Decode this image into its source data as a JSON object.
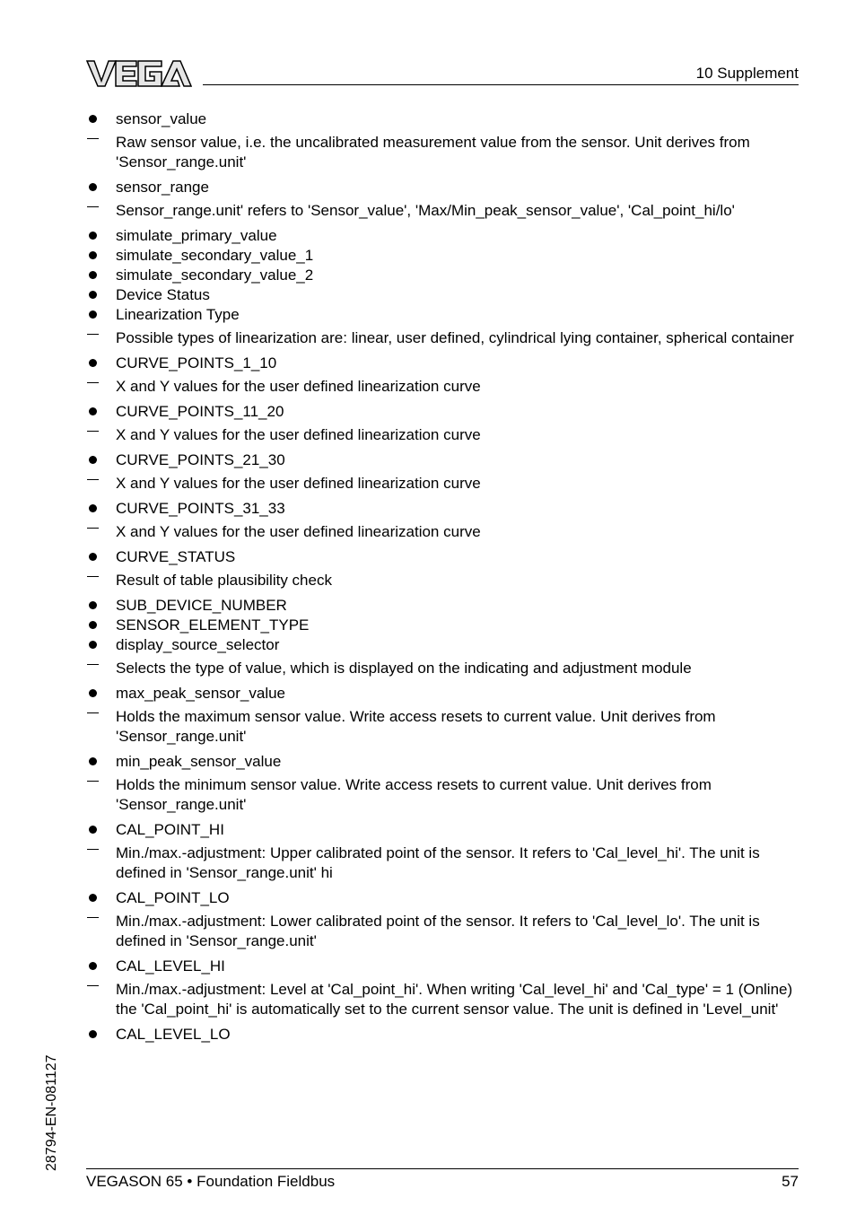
{
  "header": {
    "logo": "VEGA",
    "section": "10   Supplement"
  },
  "groups": [
    {
      "entries": [
        {
          "type": "bullet",
          "text": "sensor_value"
        },
        {
          "type": "dash",
          "text": "Raw sensor value, i.e. the uncalibrated measurement value from the sensor. Unit derives from 'Sensor_range.unit'"
        }
      ]
    },
    {
      "entries": [
        {
          "type": "bullet",
          "text": "sensor_range"
        },
        {
          "type": "dash",
          "text": "Sensor_range.unit' refers to 'Sensor_value', 'Max/Min_peak_sensor_value', 'Cal_point_hi/lo'"
        }
      ]
    },
    {
      "entries": [
        {
          "type": "bullet",
          "text": "simulate_primary_value"
        },
        {
          "type": "bullet",
          "text": "simulate_secondary_value_1"
        },
        {
          "type": "bullet",
          "text": "simulate_secondary_value_2"
        },
        {
          "type": "bullet",
          "text": "Device Status"
        },
        {
          "type": "bullet",
          "text": "Linearization Type"
        },
        {
          "type": "dash",
          "text": "Possible types of linearization are: linear, user defined, cylindrical lying container, spherical container"
        }
      ]
    },
    {
      "entries": [
        {
          "type": "bullet",
          "text": "CURVE_POINTS_1_10"
        },
        {
          "type": "dash",
          "text": "X and Y values for the user defined linearization curve"
        }
      ]
    },
    {
      "entries": [
        {
          "type": "bullet",
          "text": "CURVE_POINTS_11_20"
        },
        {
          "type": "dash",
          "text": "X and Y values for the user defined linearization curve"
        }
      ]
    },
    {
      "entries": [
        {
          "type": "bullet",
          "text": "CURVE_POINTS_21_30"
        },
        {
          "type": "dash",
          "text": "X and Y values for the user defined linearization curve"
        }
      ]
    },
    {
      "entries": [
        {
          "type": "bullet",
          "text": "CURVE_POINTS_31_33"
        },
        {
          "type": "dash",
          "text": "X and Y values for the user defined linearization curve"
        }
      ]
    },
    {
      "entries": [
        {
          "type": "bullet",
          "text": "CURVE_STATUS"
        },
        {
          "type": "dash",
          "text": "Result of table plausibility check"
        }
      ]
    },
    {
      "entries": [
        {
          "type": "bullet",
          "text": "SUB_DEVICE_NUMBER"
        },
        {
          "type": "bullet",
          "text": "SENSOR_ELEMENT_TYPE"
        },
        {
          "type": "bullet",
          "text": "display_source_selector"
        },
        {
          "type": "dash",
          "text": "Selects the type of value, which is displayed on the indicating and adjustment module"
        }
      ]
    },
    {
      "entries": [
        {
          "type": "bullet",
          "text": "max_peak_sensor_value"
        },
        {
          "type": "dash",
          "text": "Holds the maximum sensor value. Write access resets to current value. Unit derives from 'Sensor_range.unit'"
        }
      ]
    },
    {
      "entries": [
        {
          "type": "bullet",
          "text": "min_peak_sensor_value"
        },
        {
          "type": "dash",
          "text": "Holds the minimum sensor value. Write access resets to current value. Unit derives from 'Sensor_range.unit'"
        }
      ]
    },
    {
      "entries": [
        {
          "type": "bullet",
          "text": "CAL_POINT_HI"
        },
        {
          "type": "dash",
          "text": "Min./max.-adjustment: Upper calibrated point of the sensor. It refers to 'Cal_level_hi'. The unit is defined in 'Sensor_range.unit' hi"
        }
      ]
    },
    {
      "entries": [
        {
          "type": "bullet",
          "text": "CAL_POINT_LO"
        },
        {
          "type": "dash",
          "text": "Min./max.-adjustment: Lower calibrated point of the sensor. It refers to 'Cal_level_lo'. The unit is defined in 'Sensor_range.unit'"
        }
      ]
    },
    {
      "entries": [
        {
          "type": "bullet",
          "text": "CAL_LEVEL_HI"
        },
        {
          "type": "dash",
          "text": "Min./max.-adjustment: Level at 'Cal_point_hi'. When writing 'Cal_level_hi' and 'Cal_type' = 1 (Online) the 'Cal_point_hi' is automatically set to the current sensor value. The unit is defined in 'Level_unit'"
        }
      ]
    },
    {
      "entries": [
        {
          "type": "bullet",
          "text": "CAL_LEVEL_LO"
        }
      ]
    }
  ],
  "side_code": "28794-EN-081127",
  "footer": {
    "title": "VEGASON 65 • Foundation Fieldbus",
    "page_number": "57"
  }
}
